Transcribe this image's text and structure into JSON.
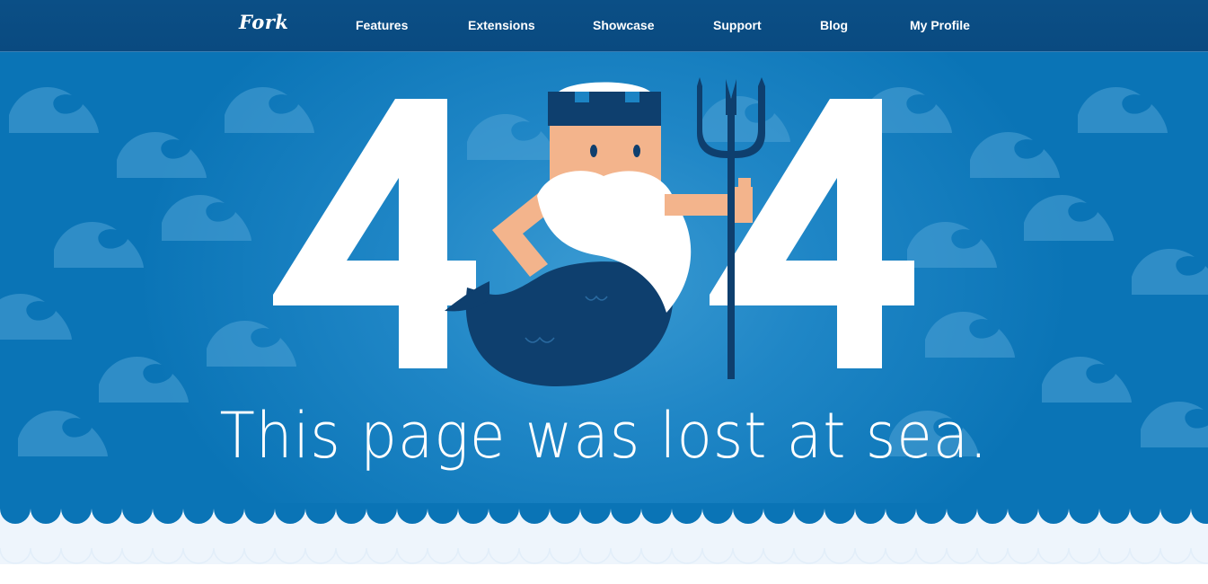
{
  "nav": {
    "logo": "Fork",
    "links": [
      "Features",
      "Extensions",
      "Showcase",
      "Support",
      "Blog",
      "My Profile"
    ]
  },
  "hero": {
    "digit_left": "4",
    "digit_right": "4",
    "message": "This page was lost at sea."
  },
  "colors": {
    "nav_bg": "#0b4f86",
    "hero_bg": "#1f86c6",
    "wave_light": "#4ea3d6",
    "character_dark": "#0e3f6e",
    "skin": "#f3b48c",
    "beard": "#ffffff",
    "footer_band": "#eef5fc"
  },
  "icons": [
    "poseidon-illustration",
    "trident-icon",
    "wave-pattern"
  ]
}
